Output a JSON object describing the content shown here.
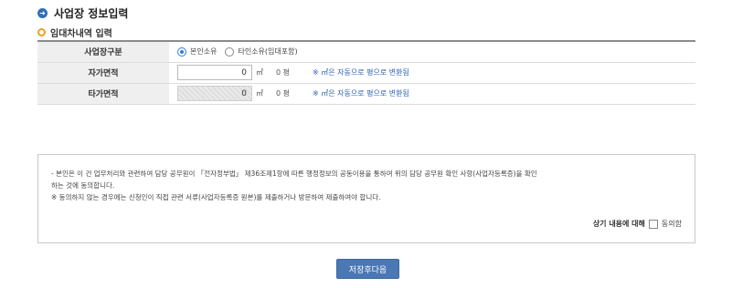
{
  "section": {
    "title": "사업장 정보입력",
    "icon": "arrow-right-circle-icon"
  },
  "subsection": {
    "title": "임대차내역 입력",
    "icon": "circle-bullet-icon"
  },
  "form": {
    "business_type": {
      "label": "사업장구분",
      "options": [
        "본인소유",
        "타인소유(임대포함)"
      ],
      "selected": "본인소유"
    },
    "own_area": {
      "label": "자가면적",
      "value": "0",
      "unit": "㎡",
      "pyeong": "0 평",
      "note": "※ ㎡은 자동으로 평으로 변환됨"
    },
    "other_area": {
      "label": "타가면적",
      "value": "0",
      "unit": "㎡",
      "pyeong": "0 평",
      "note": "※ ㎡은 자동으로 평으로 변환됨",
      "disabled": true
    }
  },
  "agreement": {
    "line1": "- 본인은 이 건 업무처리와 관련하여 담당 공무원이 「전자정부법」 제36조제1항에 따른 행정정보의 공동이용을 통하여 위의 담당 공무원 확인 사항(사업자등록증)을 확인",
    "line2": "  하는 것에 동의합니다.",
    "line3": "  ※ 동의하지 않는 경우에는 신청인이 직접 관련 서류(사업자등록증 원본)를 제출하거나 방문하여 제출하여야 합니다.",
    "confirm_label": "상기 내용에 대해",
    "check_label": "동의함",
    "checked": false
  },
  "buttons": {
    "save_next": "저장후다음"
  },
  "colors": {
    "accent": "#2f6fb7",
    "bullet": "#e6a21d",
    "button": "#4a78b4",
    "note": "#2a5fb0"
  }
}
